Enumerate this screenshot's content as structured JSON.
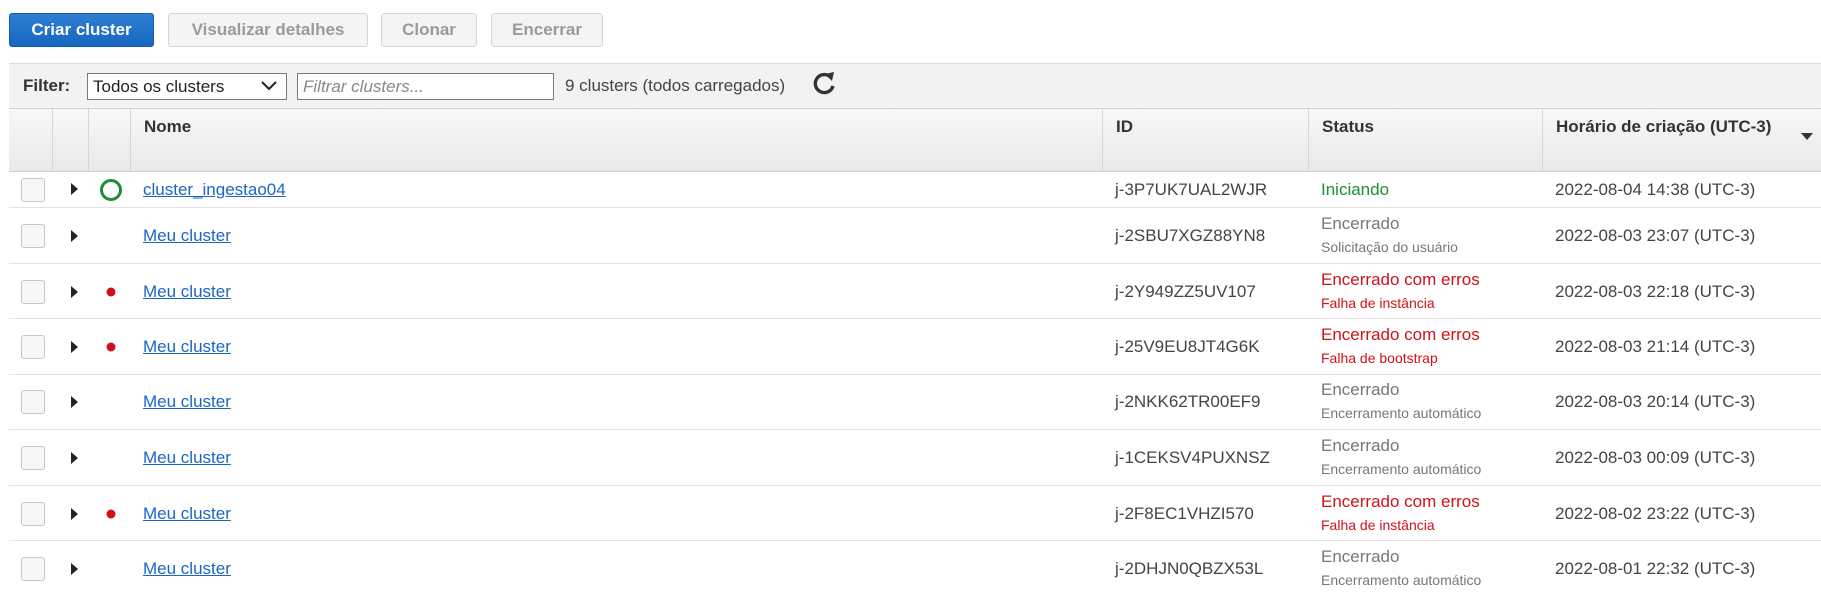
{
  "toolbar": {
    "create": "Criar cluster",
    "details": "Visualizar detalhes",
    "clone": "Clonar",
    "terminate": "Encerrar"
  },
  "filter": {
    "label": "Filter:",
    "selected": "Todos os clusters",
    "placeholder": "Filtrar clusters...",
    "count": "9 clusters (todos carregados)"
  },
  "columns": {
    "name": "Nome",
    "id": "ID",
    "status": "Status",
    "created": "Horário de criação (UTC-3)"
  },
  "rows": [
    {
      "name": "cluster_ingestao04",
      "id": "j-3P7UK7UAL2WJR",
      "status": "Iniciando",
      "detail": "",
      "date": "2022-08-04 14:38 (UTC-3)"
    },
    {
      "name": "Meu cluster",
      "id": "j-2SBU7XGZ88YN8",
      "status": "Encerrado",
      "detail": "Solicitação do usuário",
      "date": "2022-08-03 23:07 (UTC-3)"
    },
    {
      "name": "Meu cluster",
      "id": "j-2Y949ZZ5UV107",
      "status": "Encerrado com erros",
      "detail": "Falha de instância",
      "date": "2022-08-03 22:18 (UTC-3)"
    },
    {
      "name": "Meu cluster",
      "id": "j-25V9EU8JT4G6K",
      "status": "Encerrado com erros",
      "detail": "Falha de bootstrap",
      "date": "2022-08-03 21:14 (UTC-3)"
    },
    {
      "name": "Meu cluster",
      "id": "j-2NKK62TR00EF9",
      "status": "Encerrado",
      "detail": "Encerramento automático",
      "date": "2022-08-03 20:14 (UTC-3)"
    },
    {
      "name": "Meu cluster",
      "id": "j-1CEKSV4PUXNSZ",
      "status": "Encerrado",
      "detail": "Encerramento automático",
      "date": "2022-08-03 00:09 (UTC-3)"
    },
    {
      "name": "Meu cluster",
      "id": "j-2F8EC1VHZI570",
      "status": "Encerrado com erros",
      "detail": "Falha de instância",
      "date": "2022-08-02 23:22 (UTC-3)"
    },
    {
      "name": "Meu cluster",
      "id": "j-2DHJN0QBZX53L",
      "status": "Encerrado",
      "detail": "Encerramento automático",
      "date": "2022-08-01 22:32 (UTC-3)"
    }
  ],
  "colors": {
    "primary": "#1766c0",
    "link": "#1a66c6",
    "starting": "#1d8e35",
    "error": "#d0111b",
    "terminated": "#777777"
  },
  "icons": {
    "refresh": "refresh-icon",
    "select_arrow": "chevron-down-icon",
    "sort": "sort-desc-icon",
    "expand": "caret-right-icon",
    "starting": "ring-icon",
    "error": "red-dot-icon"
  }
}
